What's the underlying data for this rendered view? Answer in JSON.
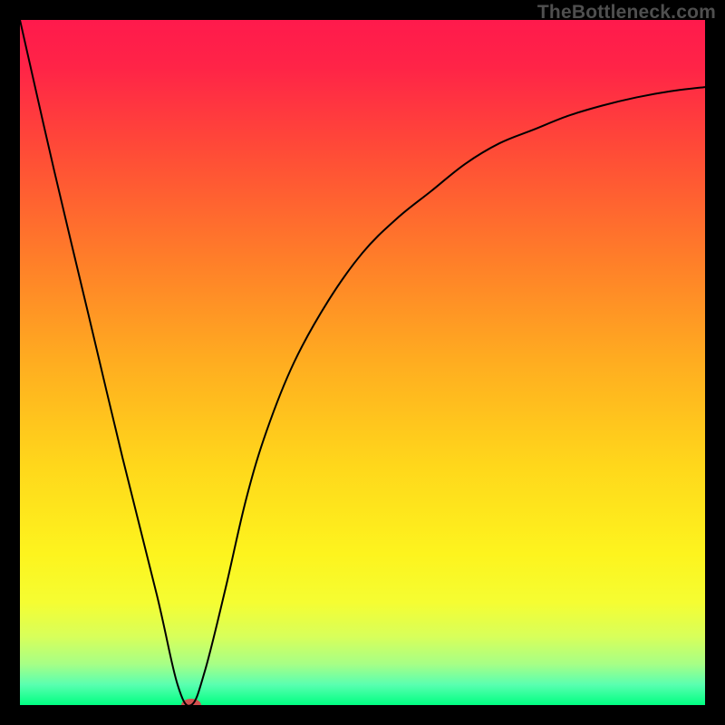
{
  "watermark": "TheBottleneck.com",
  "chart_data": {
    "type": "line",
    "title": "",
    "xlabel": "",
    "ylabel": "",
    "xlim": [
      0,
      100
    ],
    "ylim": [
      0,
      100
    ],
    "grid": false,
    "background": {
      "type": "vertical-gradient",
      "stops": [
        {
          "offset": 0.0,
          "color": "#ff1a4c"
        },
        {
          "offset": 0.07,
          "color": "#ff2447"
        },
        {
          "offset": 0.2,
          "color": "#ff4e36"
        },
        {
          "offset": 0.35,
          "color": "#ff7e29"
        },
        {
          "offset": 0.5,
          "color": "#ffad20"
        },
        {
          "offset": 0.65,
          "color": "#ffd71b"
        },
        {
          "offset": 0.78,
          "color": "#fdf41e"
        },
        {
          "offset": 0.85,
          "color": "#f5fd32"
        },
        {
          "offset": 0.9,
          "color": "#d8ff5a"
        },
        {
          "offset": 0.94,
          "color": "#a7ff86"
        },
        {
          "offset": 0.97,
          "color": "#5affb0"
        },
        {
          "offset": 1.0,
          "color": "#00ff82"
        }
      ]
    },
    "series": [
      {
        "name": "bottleneck-curve",
        "stroke": "#000000",
        "stroke_width": 2,
        "x": [
          0,
          5,
          10,
          15,
          20,
          23,
          25,
          27,
          30,
          33,
          36,
          40,
          45,
          50,
          55,
          60,
          65,
          70,
          75,
          80,
          85,
          90,
          95,
          100
        ],
        "values": [
          100,
          78,
          57,
          36,
          16,
          3,
          0,
          5,
          17,
          30,
          40,
          50,
          59,
          66,
          71,
          75,
          79,
          82,
          84,
          86,
          87.5,
          88.7,
          89.6,
          90.2
        ]
      }
    ],
    "marker": {
      "name": "optimal-point",
      "x": 25,
      "y": 0,
      "rx": 11,
      "ry": 7,
      "fill": "#d25050"
    }
  }
}
